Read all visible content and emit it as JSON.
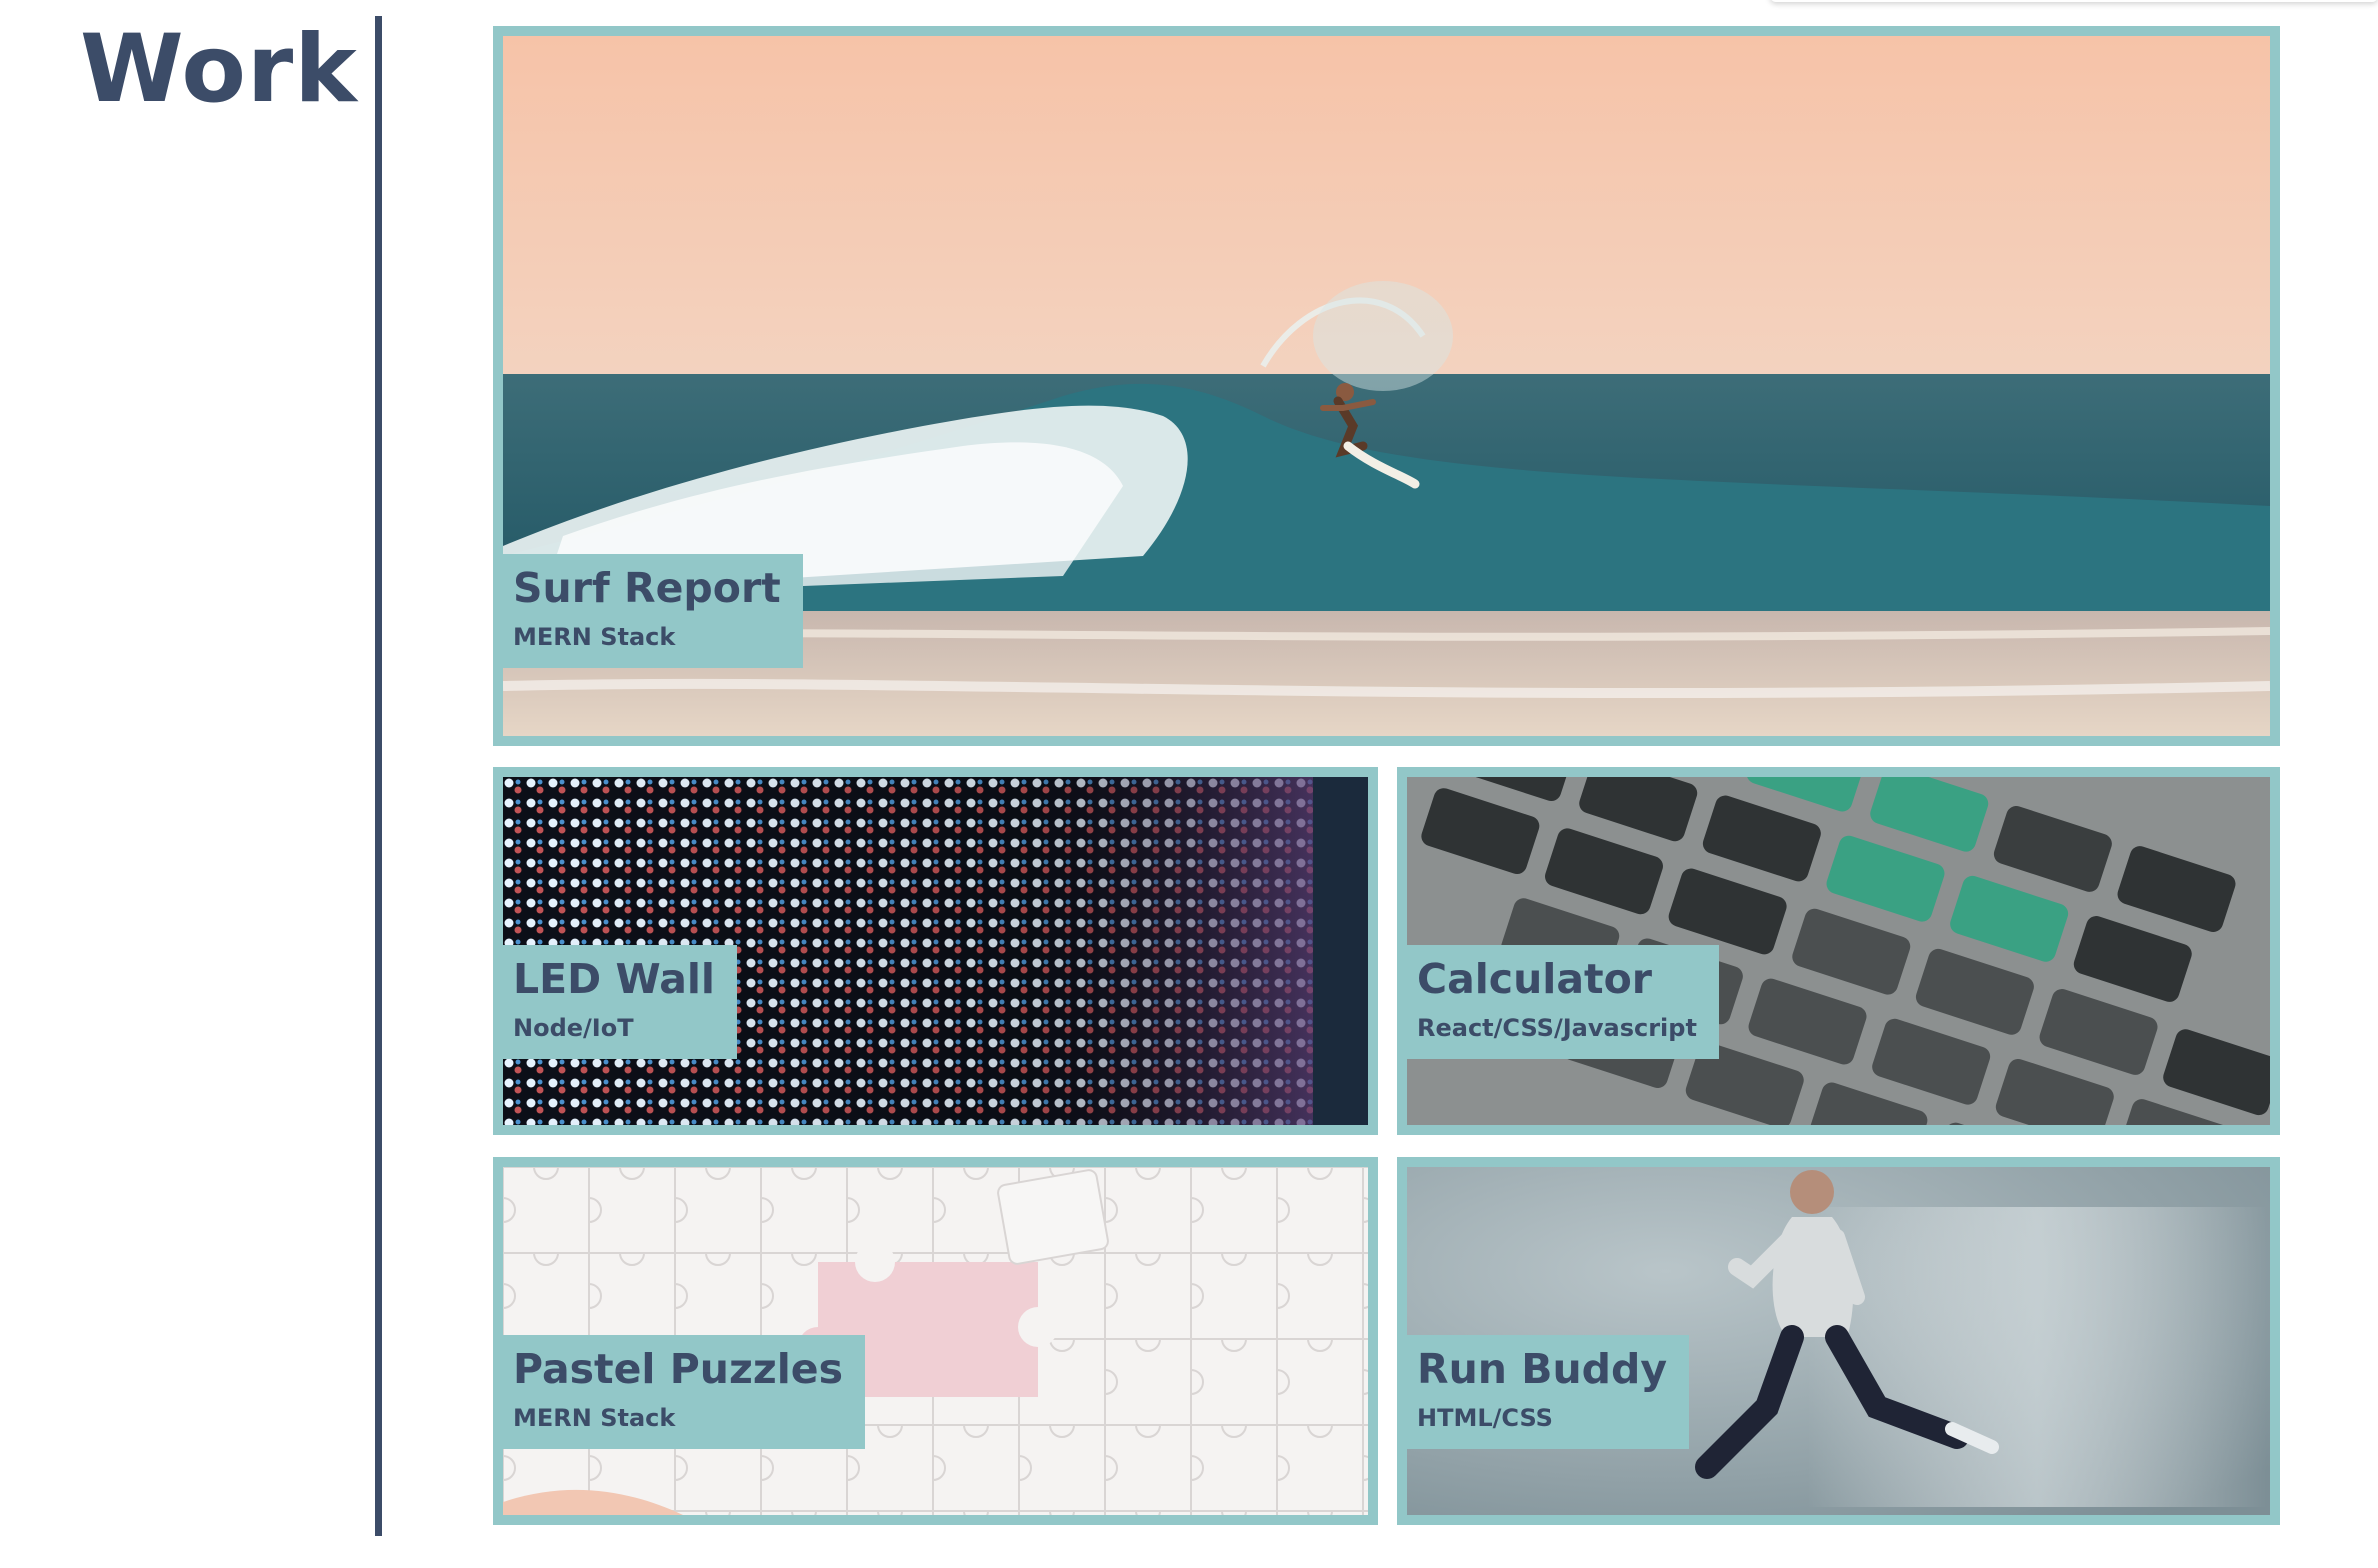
{
  "section": {
    "title": "Work"
  },
  "colors": {
    "accent": "#92c7c8",
    "heading": "#3c4c68",
    "background": "#ffffff"
  },
  "projects": [
    {
      "name": "Surf Report",
      "tech": "MERN Stack",
      "image": "surfer-on-wave-photo"
    },
    {
      "name": "LED Wall",
      "tech": "Node/IoT",
      "image": "led-pixel-wall-photo"
    },
    {
      "name": "Calculator",
      "tech": "React/CSS/Javascript",
      "image": "calculator-keypad-photo"
    },
    {
      "name": "Pastel Puzzles",
      "tech": "MERN Stack",
      "image": "jigsaw-puzzle-photo"
    },
    {
      "name": "Run Buddy",
      "tech": "HTML/CSS",
      "image": "running-man-photo"
    }
  ]
}
